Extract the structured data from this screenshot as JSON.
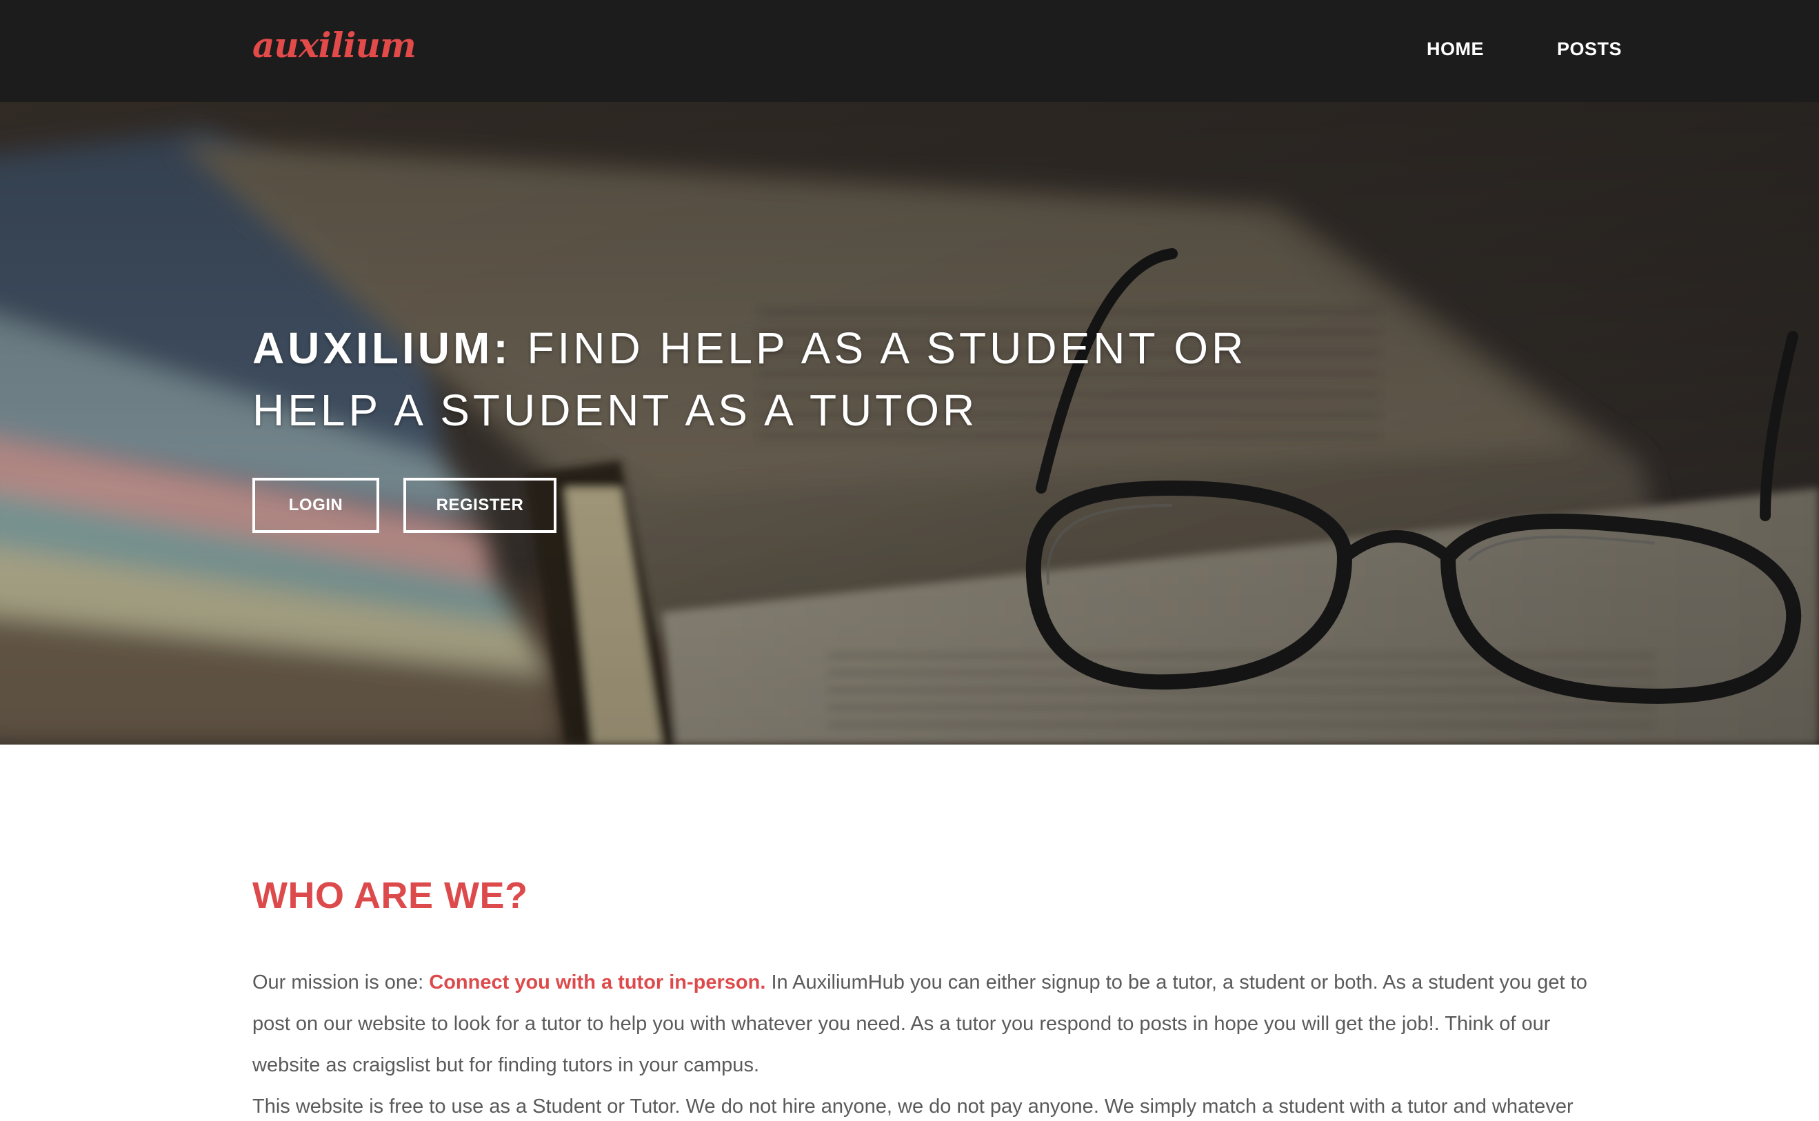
{
  "navbar": {
    "brand": "auxilium",
    "links": [
      {
        "label": "HOME"
      },
      {
        "label": "POSTS"
      }
    ]
  },
  "hero": {
    "title_strong": "AUXILIUM:",
    "title_rest": " FIND HELP AS A STUDENT OR HELP A STUDENT AS A TUTOR",
    "buttons": {
      "login": "LOGIN",
      "register": "REGISTER"
    }
  },
  "about": {
    "heading": "WHO ARE WE?",
    "para1_lead": "Our mission is one: ",
    "para1_highlight": "Connect you with a tutor in-person.",
    "para1_rest": " In AuxiliumHub you can either signup to be a tutor, a student or both. As a student you get to post on our website to look for a tutor to help you with whatever you need. As a tutor you respond to posts in hope you will get the job!. Think of our website as craigslist but for finding tutors in your campus.",
    "para2": "This website is free to use as a Student or Tutor. We do not hire anyone, we do not pay anyone. We simply match a student with a tutor and whatever"
  },
  "colors": {
    "accent": "#dd4a4c",
    "navbar_bg": "#1c1c1d",
    "body_text": "#5a5a5a"
  },
  "icons": {
    "hero_background": "books-and-glasses-photo"
  }
}
